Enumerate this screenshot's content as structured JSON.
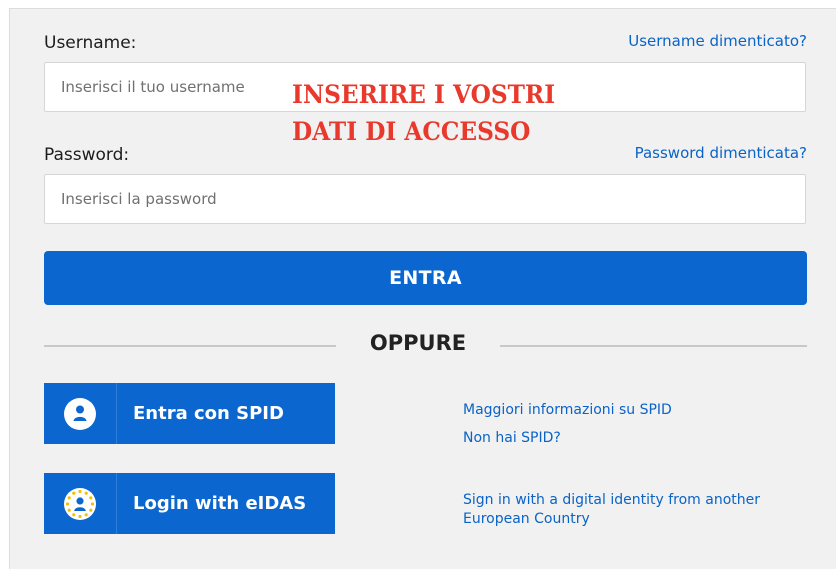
{
  "login": {
    "username_label": "Username:",
    "username_forgot": "Username dimenticato?",
    "username_placeholder": "Inserisci il tuo username",
    "password_label": "Password:",
    "password_forgot": "Password dimenticata?",
    "password_placeholder": "Inserisci la password",
    "submit_label": "ENTRA",
    "divider_text": "OPPURE"
  },
  "annotation": {
    "line1": "INSERIRE I VOSTRI",
    "line2": "DATI DI ACCESSO",
    "color": "#e8392c"
  },
  "spid": {
    "button_label": "Entra con SPID",
    "icon": "user-icon",
    "info_link": "Maggiori informazioni su SPID",
    "no_spid_link": "Non hai SPID?"
  },
  "eidas": {
    "button_label": "Login with eIDAS",
    "icon": "eu-stars-user-icon",
    "info_line1": "Sign in with a digital identity from another",
    "info_line2": "European Country"
  },
  "colors": {
    "primary": "#0b66cf",
    "link": "#0a63c7",
    "panel_bg": "#f1f1f1"
  }
}
